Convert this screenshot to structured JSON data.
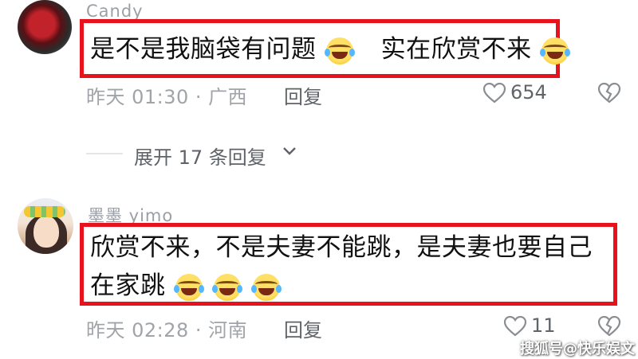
{
  "comments": [
    {
      "username": "Candy",
      "text": "是不是我脑袋有问题",
      "text_after_emoji": "实在欣赏不来",
      "emoji": "laughing-crying-emoji",
      "time": "昨天 01:30 · 广西",
      "reply_label": "回复",
      "likes": "654"
    },
    {
      "username": "墨墨 yimo",
      "line1": "欣赏不来，不是夫妻不能跳，是夫妻也要自己",
      "line2": "在家跳",
      "emoji": "laughing-crying-emoji",
      "time": "昨天 02:28 · 河南",
      "reply_label": "回复",
      "likes": "11"
    }
  ],
  "expand_replies_label": "展开 17 条回复",
  "watermark": "搜狐号@快乐娱文",
  "colors": {
    "highlight_border": "#e8121c",
    "meta_text": "#a0a4a8",
    "username_text": "#9aa0a6"
  },
  "icons": [
    "heart-icon",
    "broken-heart-icon",
    "chevron-down-icon"
  ]
}
